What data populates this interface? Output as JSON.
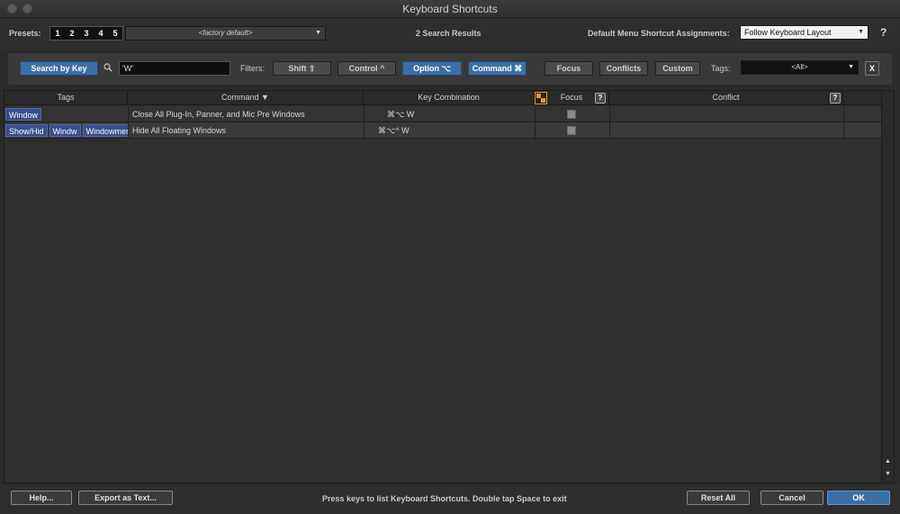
{
  "window": {
    "title": "Keyboard Shortcuts"
  },
  "presets": {
    "label": "Presets:",
    "numbers": [
      "1",
      "2",
      "3",
      "4",
      "5"
    ],
    "selected": "<factory default>"
  },
  "results_count": "2 Search Results",
  "menu_assign": {
    "label": "Default Menu Shortcut Assignments:",
    "value": "Follow Keyboard Layout",
    "help": "?"
  },
  "toolbar": {
    "search_by_key": "Search by Key",
    "search_value": "'W'",
    "filters_label": "Filters:",
    "filters": [
      "Shift ⇧",
      "Control ^",
      "Option ⌥",
      "Command ⌘"
    ],
    "views": [
      "Focus",
      "Conflicts",
      "Custom"
    ],
    "tags_label": "Tags:",
    "tags_value": "<All>",
    "clear": "X"
  },
  "table": {
    "headers": {
      "tags": "Tags",
      "command": "Command ▼",
      "key": "Key Combination",
      "focus": "Focus",
      "focus_help": "?",
      "conflict": "Conflict",
      "conflict_help": "?"
    },
    "rows": [
      {
        "tags": [
          "Window"
        ],
        "command": "Close All Plug-In, Panner, and Mic Pre Windows",
        "key": "⌘⌥ W"
      },
      {
        "tags": [
          "Show/Hid",
          "Windw",
          "Windowmer"
        ],
        "command": "Hide All Floating Windows",
        "key": "⌘⌥^ W"
      }
    ]
  },
  "footer": {
    "help": "Help...",
    "export": "Export as Text...",
    "message": "Press keys to list Keyboard Shortcuts.  Double tap Space to exit",
    "reset": "Reset All",
    "cancel": "Cancel",
    "ok": "OK"
  },
  "colors": {
    "accent": "#3c6fa6",
    "tag": "#3b4d8c"
  }
}
